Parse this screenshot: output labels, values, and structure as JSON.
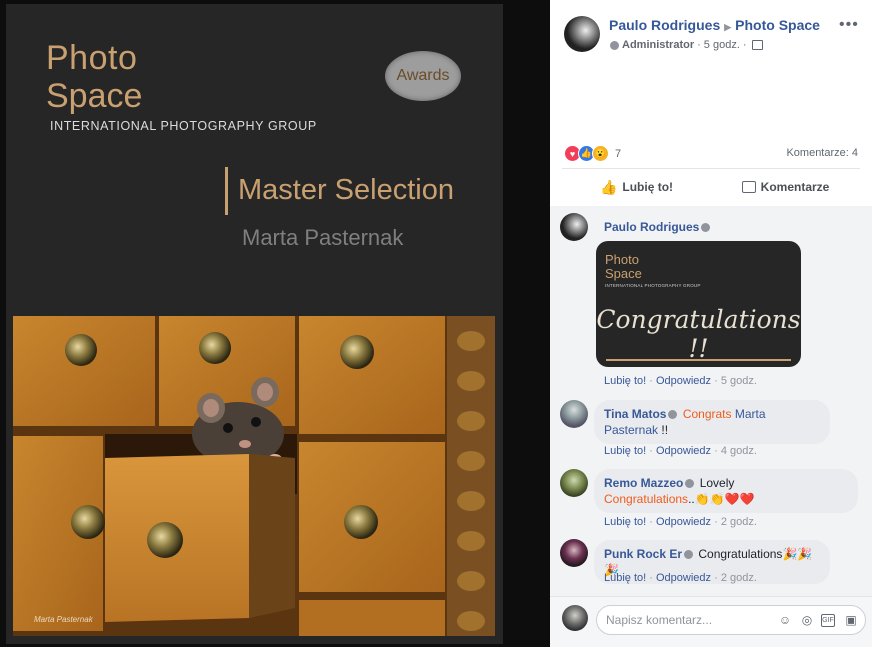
{
  "banner": {
    "logo_photo": "Photo",
    "logo_space": "Space",
    "logo_subtitle": "INTERNATIONAL PHOTOGRAPHY GROUP",
    "awards": "Awards",
    "master_selection": "Master Selection",
    "photographer": "Marta Pasternak",
    "signature": "Marta Pasternak"
  },
  "post": {
    "author": "Paulo Rodrigues",
    "group": "Photo Space",
    "role": "Administrator",
    "time": "5 godz.",
    "reactions_count": "7",
    "comments_label": "Komentarze: 4",
    "like_label": "Lubię to!",
    "comment_label": "Komentarze"
  },
  "comments": [
    {
      "author": "Paulo Rodrigues",
      "card_photo": "Photo",
      "card_space": "Space",
      "card_subtitle": "INTERNATIONAL PHOTOGRAPHY GROUP",
      "card_text": "Congratulations !!",
      "like": "Lubię to!",
      "reply": "Odpowiedz",
      "time": "5 godz."
    },
    {
      "author": "Tina Matos",
      "highlight": "Congrats",
      "mention": "Marta Pasternak",
      "text_end": "!!",
      "like": "Lubię to!",
      "reply": "Odpowiedz",
      "time": "4 godz."
    },
    {
      "author": "Remo Mazzeo",
      "text": "Lovely",
      "highlight": "Congratulations",
      "emoji": "..👏👏❤️❤️",
      "like": "Lubię to!",
      "reply": "Odpowiedz",
      "time": "2 godz."
    },
    {
      "author": "Punk Rock Er",
      "text": "Congratulations",
      "emoji": "🎉🎉🎉",
      "like": "Lubię to!",
      "reply": "Odpowiedz",
      "time": "2 godz."
    }
  ],
  "compose": {
    "placeholder": "Napisz komentarz..."
  },
  "colors": {
    "link_blue": "#385898",
    "gold": "#c9a070",
    "highlight_orange": "#f05c1c"
  }
}
